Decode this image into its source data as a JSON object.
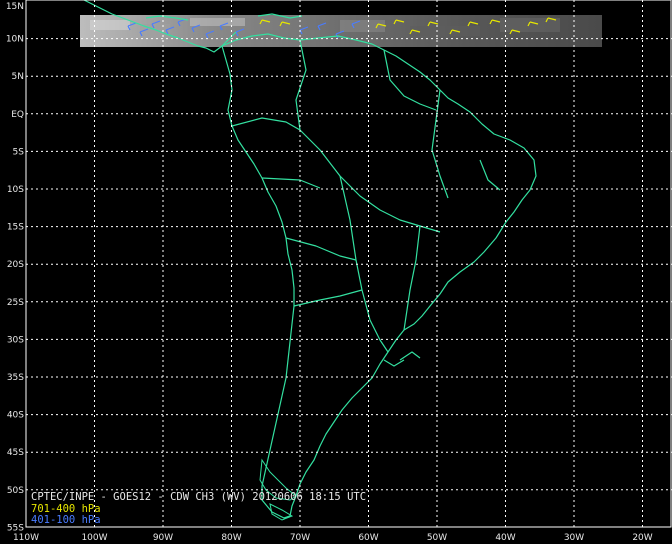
{
  "image": {
    "type": "satellite wind product map",
    "background_color": "#000000",
    "grid_color": "#ffffff",
    "coastline_color": "#33e0a0",
    "satellite_strip": "grayscale GOES12 CH3 water-vapour imagery strip near 10N"
  },
  "caption": {
    "title": "CPTEC/INPE - GOES12 - CDW CH3 (WV) 20120606 18:15 UTC",
    "legend_mid": "701-400 hPa",
    "legend_high": "401-100 hPa",
    "legend_mid_color": "#e6e600",
    "legend_high_color": "#4a7cff"
  },
  "latitude_labels": [
    "15N",
    "10N",
    "5N",
    "EQ",
    "5S",
    "10S",
    "15S",
    "20S",
    "25S",
    "30S",
    "35S",
    "40S",
    "45S",
    "50S",
    "55S"
  ],
  "longitude_labels": [
    "110W",
    "100W",
    "90W",
    "80W",
    "70W",
    "60W",
    "50W",
    "40W",
    "30W",
    "20W"
  ],
  "wind_barbs": {
    "layer_701_400_hPa": "yellow barbs plotted over the northern strip near 10N, ~72W to 38W",
    "layer_401_100_hPa": "blue barbs plotted over the northern strip near 10N, ~88W to 54W"
  }
}
